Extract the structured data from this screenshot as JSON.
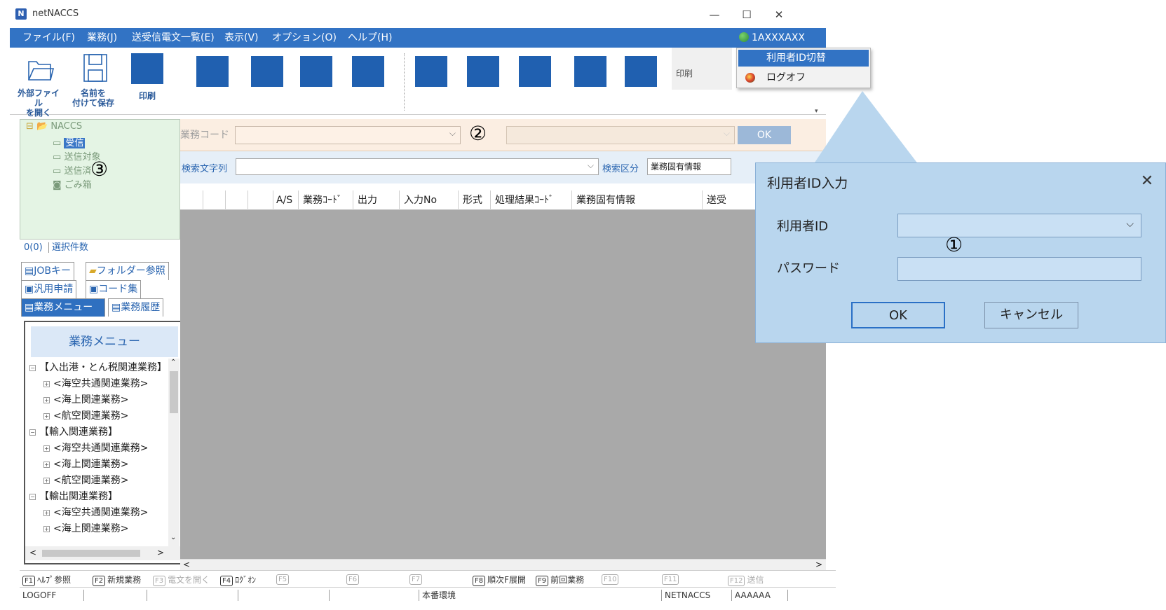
{
  "window": {
    "app_title": "netNACCS",
    "logo_letter": "N",
    "minimize": "—",
    "maximize": "☐",
    "close": "✕"
  },
  "menubar": {
    "items": [
      "ファイル(F)",
      "業務(J)",
      "送受信電文一覧(E)",
      "表示(V)",
      "オプション(O)",
      "ヘルプ(H)"
    ],
    "user": "1AXXXAXX"
  },
  "user_dropdown": {
    "items": [
      "利用者ID切替",
      "ログオフ"
    ],
    "peek_label": "印刷"
  },
  "toolbar": {
    "open_external": "外部ファイル\nを開く",
    "save_as": "名前を\n付けて保存",
    "print": "印刷"
  },
  "codebar": {
    "code_label": "業務コード",
    "annotation": "②",
    "ok": "OK",
    "caret": "⌵"
  },
  "filterbar": {
    "search_label": "検索文字列",
    "search_value": "",
    "category_label": "検索区分",
    "category_value": "業務固有情報"
  },
  "grid": {
    "columns": [
      "",
      "",
      "",
      "",
      "A/S",
      "業務ｺｰﾄﾞ",
      "出力",
      "入力No",
      "形式",
      "処理結果ｺｰﾄﾞ",
      "業務固有情報",
      "送受"
    ]
  },
  "tree": {
    "root": "NACCS",
    "items": [
      "受信",
      "送信対象",
      "送信済",
      "ごみ箱"
    ],
    "annotation": "③"
  },
  "selection": {
    "count": "0(0)",
    "label": "選択件数"
  },
  "tabs": [
    "JOBキー",
    "フォルダー参照",
    "汎用申請",
    "コード集",
    "業務メニュー",
    "業務履歴"
  ],
  "business_menu": {
    "header": "業務メニュー",
    "items": [
      {
        "level": 0,
        "text": "【入出港・とん税関連業務】"
      },
      {
        "level": 1,
        "text": "<海空共通関連業務>"
      },
      {
        "level": 1,
        "text": "<海上関連業務>"
      },
      {
        "level": 1,
        "text": "<航空関連業務>"
      },
      {
        "level": 0,
        "text": "【輸入関連業務】"
      },
      {
        "level": 1,
        "text": "<海空共通関連業務>"
      },
      {
        "level": 1,
        "text": "<海上関連業務>"
      },
      {
        "level": 1,
        "text": "<航空関連業務>"
      },
      {
        "level": 0,
        "text": "【輸出関連業務】"
      },
      {
        "level": 1,
        "text": "<海空共通関連業務>"
      },
      {
        "level": 1,
        "text": "<海上関連業務>"
      }
    ]
  },
  "fkeys": [
    {
      "key": "F1",
      "label": "ﾍﾙﾌﾟ参照",
      "enabled": true
    },
    {
      "key": "F2",
      "label": "新規業務",
      "enabled": true
    },
    {
      "key": "F3",
      "label": "電文を開く",
      "enabled": false
    },
    {
      "key": "F4",
      "label": "ﾛｸﾞｵﾝ",
      "enabled": true
    },
    {
      "key": "F5",
      "label": "",
      "enabled": false
    },
    {
      "key": "F6",
      "label": "",
      "enabled": false
    },
    {
      "key": "F7",
      "label": "",
      "enabled": false
    },
    {
      "key": "F8",
      "label": "順次F展開",
      "enabled": true
    },
    {
      "key": "F9",
      "label": "前回業務",
      "enabled": true
    },
    {
      "key": "F10",
      "label": "",
      "enabled": false
    },
    {
      "key": "F11",
      "label": "",
      "enabled": false
    },
    {
      "key": "F12",
      "label": "送信",
      "enabled": false
    }
  ],
  "statusbar": {
    "state": "LOGOFF",
    "env": "本番環境",
    "system": "NETNACCS",
    "user": "AAAAAA"
  },
  "dialog": {
    "title": "利用者ID入力",
    "close": "✕",
    "userid_label": "利用者ID",
    "userid_value": "",
    "password_label": "パスワード",
    "password_value": "",
    "ok": "OK",
    "cancel": "キャンセル",
    "annotation": "①"
  },
  "colors": {
    "menubar": "#3273c4",
    "grid_bg": "#a9a9a9",
    "dialog_bg": "#b9d6ee",
    "tree_bg": "#e4f4e4"
  }
}
